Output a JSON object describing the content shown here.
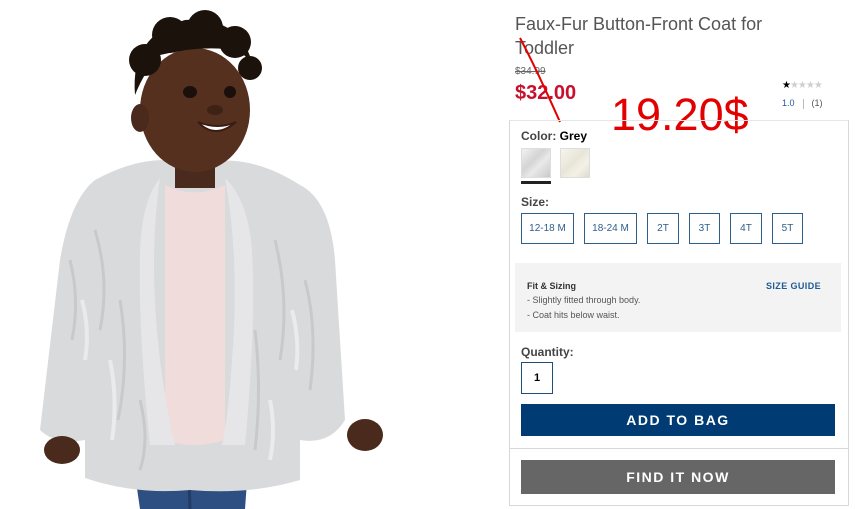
{
  "product": {
    "title": "Faux-Fur Button-Front Coat for Toddler",
    "original_price": "$34.99",
    "sale_price": "$32.00",
    "rating": {
      "stars": "★★★★★",
      "value": "1.0",
      "count": "(1)",
      "score_out_of_5": 1
    }
  },
  "annotation": {
    "price_text": "19.20$",
    "color": "#e30000"
  },
  "color": {
    "label": "Color:",
    "selected": "Grey",
    "swatches": [
      "Grey",
      "Cream"
    ]
  },
  "size": {
    "label": "Size:",
    "options": [
      "12-18 M",
      "18-24 M",
      "2T",
      "3T",
      "4T",
      "5T"
    ]
  },
  "fit": {
    "title": "Fit & Sizing",
    "guide_link": "SIZE GUIDE",
    "lines": [
      "- Slightly fitted through body.",
      "- Coat hits below waist."
    ]
  },
  "quantity": {
    "label": "Quantity:",
    "value": "1"
  },
  "buttons": {
    "add_to_bag": "ADD TO BAG",
    "find_it_now": "FIND IT NOW"
  },
  "colors": {
    "sale_red": "#c8102e",
    "primary_navy": "#003b73",
    "secondary_grey": "#666666",
    "link_blue": "#1f5a96"
  }
}
